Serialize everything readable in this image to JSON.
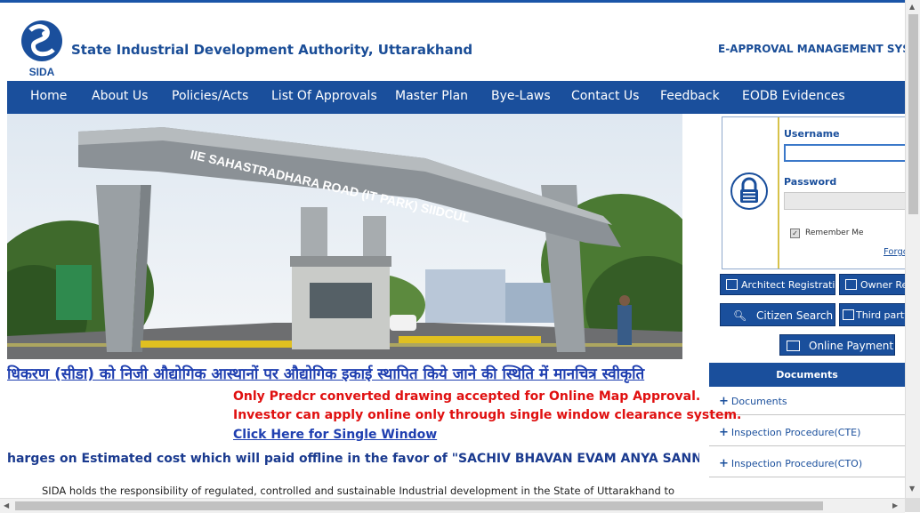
{
  "header": {
    "logo_text": "SIDA",
    "site_title": "State Industrial Development Authority, Uttarakhand",
    "system_title": "E-APPROVAL MANAGEMENT SYSTEM"
  },
  "nav": {
    "items": [
      "Home",
      "About Us",
      "Policies/Acts",
      "List Of Approvals",
      "Master Plan",
      "Bye-Laws",
      "Contact Us",
      "Feedback",
      "EODB Evidences"
    ]
  },
  "banner": {
    "gate_sign": "IIE SAHASTRADHARA ROAD (IT PARK) SIIDCUL"
  },
  "login": {
    "username_label": "Username",
    "password_label": "Password",
    "remember_label": "Remember Me",
    "remember_checked": true,
    "forgot_label": "Forgo"
  },
  "actions": {
    "architect_registration": "Architect Registration",
    "owner_registration": "Owner Re",
    "citizen_search": "Citizen Search",
    "third_party": "Third party A",
    "online_payment": "Online Payment"
  },
  "documents": {
    "heading": "Documents",
    "items": [
      "Documents",
      "Inspection Procedure(CTE)",
      "Inspection Procedure(CTO)"
    ]
  },
  "main": {
    "hindi_marquee": "धिकरण (सीडा) को निजी औद्योगिक आस्थानों पर औद्योगिक इकाई स्थापित किये जाने की स्थिति में मानचित्र स्वीकृति",
    "notice_1": "Only Predcr converted drawing accepted for Online Map Approval.",
    "notice_2": "Investor can apply online only through single window clearance system.",
    "single_window_link": "Click Here for Single Window",
    "charges_marquee": "harges on Estimated cost which will paid offline in the favor of \"SACHIV BHAVAN EVAM ANYA SANNIRMAN KARI",
    "intro_text": "SIDA holds the responsibility of regulated, controlled and sustainable Industrial development in the State of Uttarakhand to"
  },
  "colors": {
    "brand_blue": "#1a4f9c",
    "notice_red": "#e01010",
    "link_blue": "#1f3fb0"
  }
}
